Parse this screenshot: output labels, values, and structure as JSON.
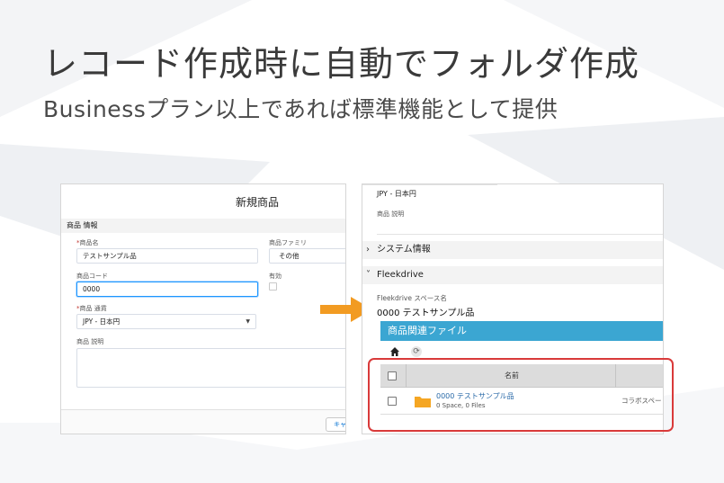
{
  "headline": "レコード作成時に自動でフォルダ作成",
  "subheadline": "Businessプラン以上であれば標準機能として提供",
  "colors": {
    "accent": "#3ba6d2",
    "arrow": "#f29b22",
    "highlight": "#d93a3a",
    "folder": "#f5a623"
  },
  "left_panel": {
    "title": "新規商品",
    "section": "商品 情報",
    "fields": {
      "product_name_label": "商品名",
      "product_name_value": "テストサンプル品",
      "product_family_label": "商品ファミリ",
      "product_family_value": "その他",
      "product_code_label": "商品コード",
      "product_code_value": "0000",
      "active_label": "有効",
      "currency_label": "商品 通貨",
      "currency_value": "JPY - 日本円",
      "description_label": "商品 説明"
    },
    "required_mark": "*",
    "cancel_label": "キャ"
  },
  "right_panel": {
    "currency_value": "JPY - 日本円",
    "description_label": "商品 説明",
    "system_info_label": "システム情報",
    "fleekdrive_label": "Fleekdrive",
    "space_name_label": "Fleekdrive スペース名",
    "space_name_value": "0000 テストサンプル品",
    "files_header": "商品関連ファイル",
    "table": {
      "col_name": "名前",
      "row": {
        "title": "0000 テストサンプル品",
        "subtitle": "0 Space, 0 Files",
        "extra": "コラボスペー"
      }
    }
  }
}
